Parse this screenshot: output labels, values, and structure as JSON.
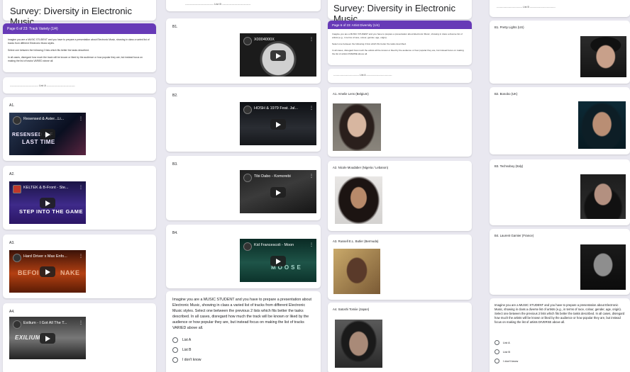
{
  "col1": {
    "form_title": "Survey: Diversity in Electronic Music",
    "page_header": "Page 6 of 23: Track Variety (1/4)",
    "desc_1": "Imagine you are a MUSIC STUDENT and you have to prepare a presentation about Electronic Music, showing in class a varied list of tracks from different Electronic Music styles.",
    "desc_2": "Select one between the following 2 lists which fits better the tasks described.",
    "desc_3": "In all cases, disregard how much the track will be known or liked by the audience or how popular they are, but instead focus on making the list of tracks VARIED above all.",
    "list_a_divider": "------------------------------ List A ------------------------------",
    "items": [
      {
        "label": "A1.",
        "video_title": "Resensed & Aster...Li...",
        "overlay": "RESENSED & F\nLAST TIME"
      },
      {
        "label": "A2.",
        "video_title": "KELTEK & B-Front - Ste...",
        "overlay": "STEP INTO THE GAME"
      },
      {
        "label": "A3.",
        "video_title": "Hard Driver x Max Enfo...",
        "overlay": "BEFOI    NAKE"
      },
      {
        "label": "A4.",
        "video_title": "Exilium - I Got All The T...",
        "overlay": "EXILIUM"
      }
    ]
  },
  "col2": {
    "list_b_divider": "------------------------------ List B ------------------------------",
    "items": [
      {
        "label": "B1.",
        "video_title": "X0004000X",
        "overlay": ""
      },
      {
        "label": "B2.",
        "video_title": "HOSH & 1979 Feat. Jal...",
        "overlay": ""
      },
      {
        "label": "B3.",
        "video_title": "Tibi Dabo - Komorebi",
        "overlay": ""
      },
      {
        "label": "B4.",
        "video_title": "Kid Francescoli - Moon",
        "overlay": "MOOSE"
      }
    ],
    "question": "Imagine you are a MUSIC STUDENT and you have to prepare a presentation about Electronic Music, showing in class a varied list of tracks from different Electronic Music styles. Select one between the previous 2 lists which fits better the tasks described. In all cases, disregard how much the track will be known or liked by the audience or how popular they are, but instead focus on making the list of tracks VARIED above all.",
    "options": [
      "List A",
      "List B",
      "I don't know"
    ]
  },
  "col3": {
    "form_title": "Survey: Diversity in Electronic Music",
    "page_header": "Page 6 of 23: Artist Diversity (1/4)",
    "desc_1": "Imagine you are a MUSIC STUDENT and you have to prepare a presentation about Electronic Music, showing in class a diverse list of artists (e.g., in terms of race, colour, gender, age, origin).",
    "desc_2": "Select one between the following 2 lists which fits better the tasks described.",
    "desc_3": "In all cases, disregard how much the artists will be known or liked by the audience or how popular they are, but instead focus on making the list of artists DIVERSE above all.",
    "list_a_divider": "------------------------------ List A ------------------------------",
    "items": [
      {
        "label": "A1. Amelie Lens (Belgium)"
      },
      {
        "label": "A2. Nicole Moudaber (Nigeria / Lebanon)"
      },
      {
        "label": "A3. Russell E.L. Butler (Bermuda)"
      },
      {
        "label": "A4. Satoshi Tomiie (Japan)"
      }
    ]
  },
  "col4": {
    "list_b_divider": "------------------------------ List B ------------------------------",
    "items": [
      {
        "label": "B1. Pretty Lights (US)"
      },
      {
        "label": "B2. Bonobo (UK)"
      },
      {
        "label": "B3. Technoboy (Italy)"
      },
      {
        "label": "B4. Laurent Garnier (France)"
      }
    ],
    "question": "Imagine you are a MUSIC STUDENT and you have to prepare a presentation about Electronic Music, showing in class a diverse list of artists (e.g., in terms of race, colour, gender, age, origin). Select one between the previous 2 lists which fits better the tasks described. In all cases, disregard how much the artists will be known or liked by the audience or how popular they are, but instead focus on making the list of artists DIVERSE above all.",
    "options": [
      "List A",
      "List B",
      "I don't know"
    ]
  },
  "colors": {
    "accent": "#673ab7",
    "background": "#e9e8f0"
  }
}
